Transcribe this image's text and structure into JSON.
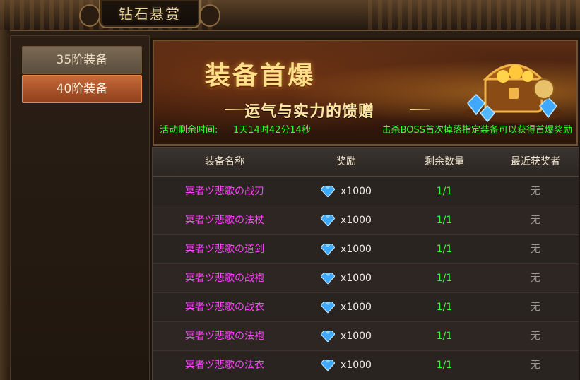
{
  "window": {
    "title": "钻石悬赏"
  },
  "sidebar": {
    "tabs": [
      {
        "label": "35阶装备",
        "selected": false
      },
      {
        "label": "40阶装备",
        "selected": true
      }
    ]
  },
  "banner": {
    "title": "装备首爆",
    "subtitle": "运气与实力的馈赠",
    "countdown_label": "活动剩余时间:",
    "countdown_value": "1天14时42分14秒",
    "description": "击杀BOSS首次掉落指定装备可以获得首爆奖励"
  },
  "table": {
    "headers": [
      "装备名称",
      "奖励",
      "剩余数量",
      "最近获奖者"
    ],
    "rows": [
      {
        "name": "冥者ヅ悲歌の战刃",
        "reward": "x1000",
        "remaining": "1/1",
        "winner": "无"
      },
      {
        "name": "冥者ヅ悲歌の法杖",
        "reward": "x1000",
        "remaining": "1/1",
        "winner": "无"
      },
      {
        "name": "冥者ヅ悲歌の道剑",
        "reward": "x1000",
        "remaining": "1/1",
        "winner": "无"
      },
      {
        "name": "冥者ヅ悲歌の战袍",
        "reward": "x1000",
        "remaining": "1/1",
        "winner": "无"
      },
      {
        "name": "冥者ヅ悲歌の战衣",
        "reward": "x1000",
        "remaining": "1/1",
        "winner": "无"
      },
      {
        "name": "冥者ヅ悲歌の法袍",
        "reward": "x1000",
        "remaining": "1/1",
        "winner": "无"
      },
      {
        "name": "冥者ヅ悲歌の法衣",
        "reward": "x1000",
        "remaining": "1/1",
        "winner": "无"
      }
    ]
  },
  "colors": {
    "item_name": "#ff44ff",
    "remaining": "#37ff37",
    "countdown": "#37ff37",
    "selected_tab": "#c66a3a",
    "gem": "#3fa8ff"
  },
  "icons": {
    "reward_icon": "diamond-icon",
    "banner_art": "treasure-chest-icon"
  }
}
